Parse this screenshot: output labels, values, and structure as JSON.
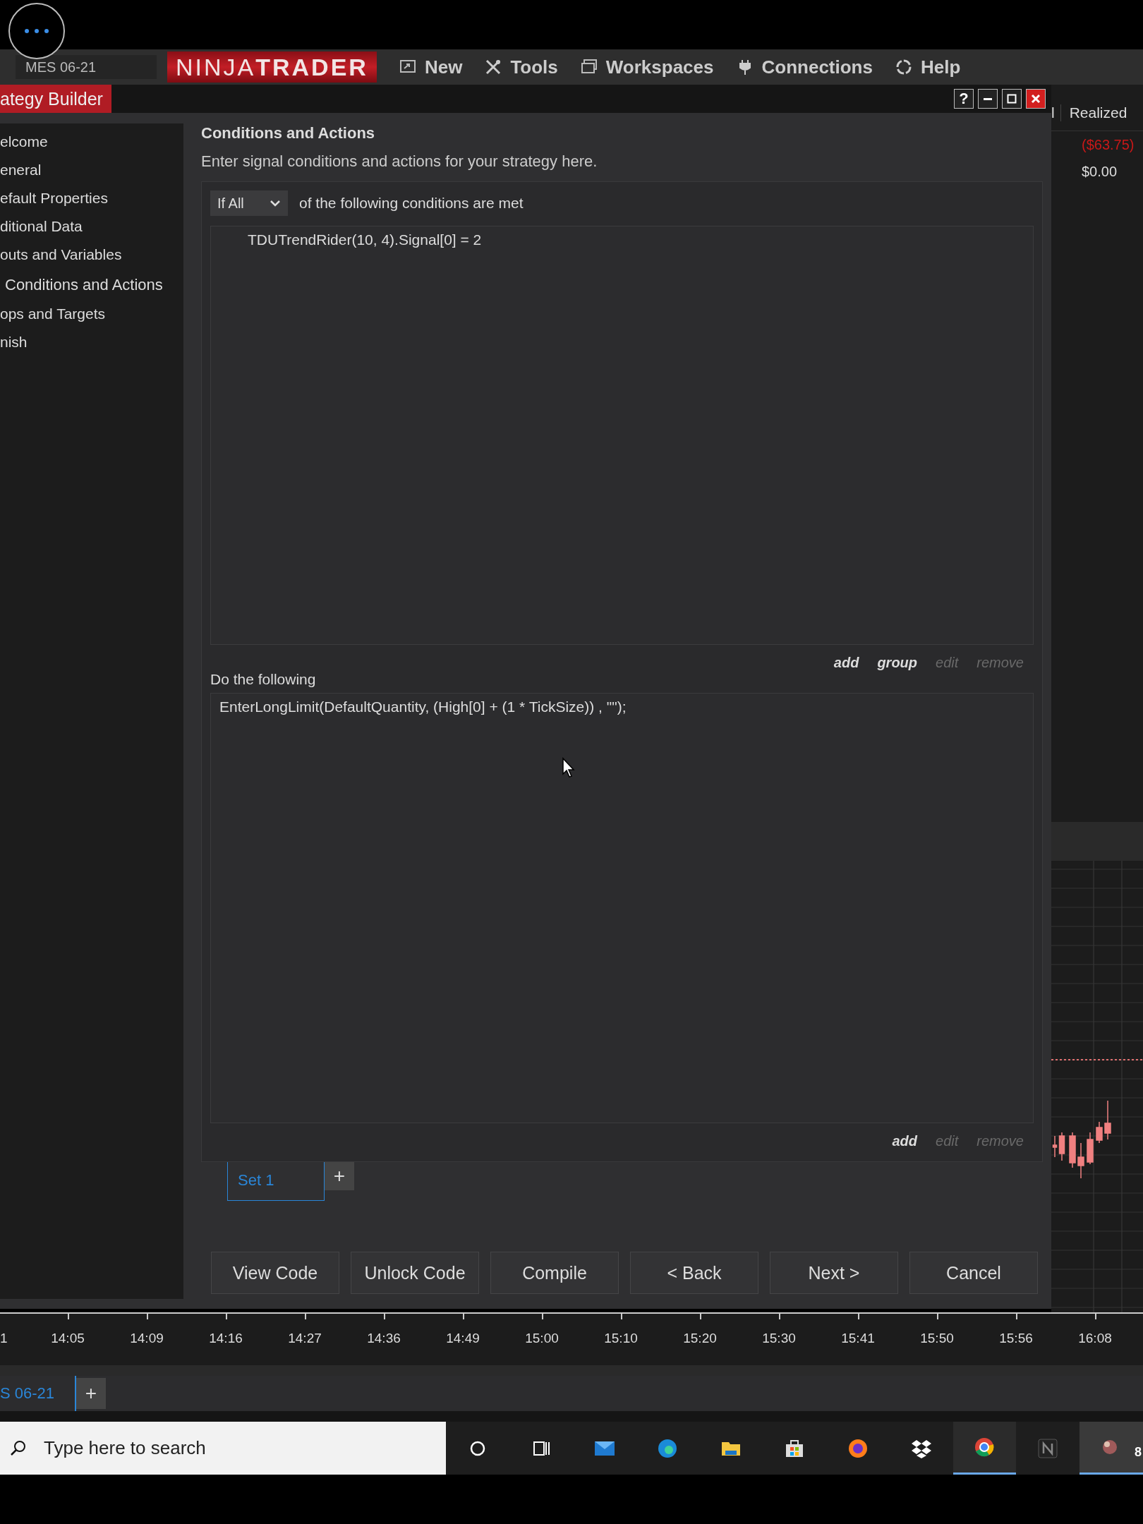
{
  "menu_bar": {
    "instrument": "MES 06-21",
    "logo": "NINJA**TRADER**",
    "items": [
      {
        "label": "New",
        "kind": "new"
      },
      {
        "label": "Tools",
        "kind": "tools"
      },
      {
        "label": "Workspaces",
        "kind": "workspaces"
      },
      {
        "label": "Connections",
        "kind": "connections"
      },
      {
        "label": "Help",
        "kind": "help"
      }
    ]
  },
  "window": {
    "title": "ategy Builder",
    "help_label": "?"
  },
  "sidebar": {
    "items": [
      {
        "label": "elcome",
        "selected": false
      },
      {
        "label": "eneral",
        "selected": false
      },
      {
        "label": "efault Properties",
        "selected": false
      },
      {
        "label": "ditional Data",
        "selected": false
      },
      {
        "label": "outs and Variables",
        "selected": false
      },
      {
        "label": "Conditions and Actions",
        "selected": true
      },
      {
        "label": "ops and Targets",
        "selected": false
      },
      {
        "label": "nish",
        "selected": false
      }
    ]
  },
  "page": {
    "heading": "Conditions and Actions",
    "description": "Enter signal conditions and actions for your strategy here."
  },
  "conditions": {
    "mode": "If All",
    "suffix": "of the following conditions are met",
    "items": [
      "TDUTrendRider(10, 4).Signal[0] = 2"
    ],
    "links": [
      {
        "label": "add",
        "disabled": false
      },
      {
        "label": "group",
        "disabled": false
      },
      {
        "label": "edit",
        "disabled": true
      },
      {
        "label": "remove",
        "disabled": true
      }
    ]
  },
  "actions": {
    "heading": "Do the following",
    "items": [
      "EnterLongLimit(DefaultQuantity, (High[0] + (1 * TickSize)) , \"\");"
    ],
    "links": [
      {
        "label": "add",
        "disabled": false
      },
      {
        "label": "edit",
        "disabled": true
      },
      {
        "label": "remove",
        "disabled": true
      }
    ]
  },
  "sets": {
    "tabs": [
      {
        "label": "Set 1",
        "selected": true
      }
    ],
    "add_label": "+"
  },
  "buttons": [
    "View Code",
    "Unlock Code",
    "Compile",
    "< Back",
    "Next >",
    "Cancel"
  ],
  "background_grid": {
    "columns": [
      "l",
      "Realized"
    ],
    "values": [
      {
        "text": "($63.75)",
        "negative": true
      },
      {
        "text": "$0.00",
        "negative": false
      }
    ]
  },
  "time_axis": [
    "1",
    "14:05",
    "14:09",
    "14:16",
    "14:27",
    "14:36",
    "14:49",
    "15:00",
    "15:10",
    "15:20",
    "15:30",
    "15:41",
    "15:50",
    "15:56",
    "16:08"
  ],
  "bottom_tabs": {
    "tabs": [
      {
        "label": "S 06-21",
        "selected": true
      }
    ],
    "add_label": "+"
  },
  "taskbar": {
    "search_placeholder": "Type here to search",
    "apps": [
      {
        "kind": "cortana",
        "active": false
      },
      {
        "kind": "taskview",
        "active": false
      },
      {
        "kind": "mail",
        "active": false
      },
      {
        "kind": "edge",
        "active": false
      },
      {
        "kind": "folder",
        "active": false
      },
      {
        "kind": "store",
        "active": false
      },
      {
        "kind": "firefox",
        "active": false
      },
      {
        "kind": "dropbox",
        "active": false
      },
      {
        "kind": "chrome",
        "active": true
      },
      {
        "kind": "ninja",
        "active": false
      },
      {
        "kind": "app",
        "active": true
      }
    ],
    "badge": "8"
  }
}
